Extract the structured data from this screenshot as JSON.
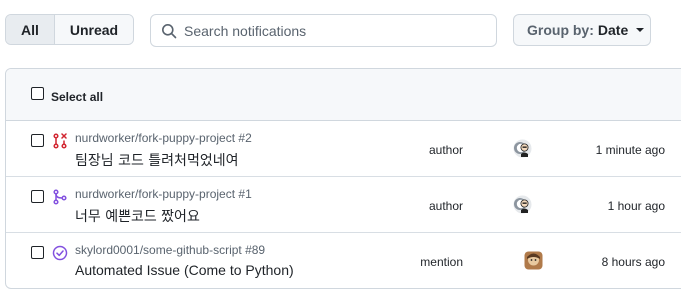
{
  "filters": {
    "all_label": "All",
    "unread_label": "Unread"
  },
  "search": {
    "placeholder": "Search notifications",
    "value": ""
  },
  "group_by": {
    "label": "Group by:",
    "value": "Date"
  },
  "list": {
    "select_all_label": "Select all",
    "items": [
      {
        "icon": "pull-request-closed-icon",
        "icon_color": "#d1242f",
        "repo": "nurdworker/fork-puppy-project #2",
        "title": "팀장님 코드 틀려처먹었네여",
        "reason": "author",
        "avatar": "avatar-icon",
        "time": "1 minute ago"
      },
      {
        "icon": "pull-request-merged-icon",
        "icon_color": "#8250df",
        "repo": "nurdworker/fork-puppy-project #1",
        "title": "너무 예쁜코드 짰어요",
        "reason": "author",
        "avatar": "avatar-icon",
        "time": "1 hour ago"
      },
      {
        "icon": "issue-closed-icon",
        "icon_color": "#8250df",
        "repo": "skylord0001/some-github-script #89",
        "title": "Automated Issue (Come to Python)",
        "reason": "mention",
        "avatar": "avatar-icon",
        "time": "8 hours ago"
      }
    ]
  },
  "colors": {
    "border": "#d0d7de",
    "header_bg": "#f6f8fa",
    "muted_text": "#59636e",
    "closed_red": "#d1242f",
    "merged_purple": "#8250df"
  }
}
